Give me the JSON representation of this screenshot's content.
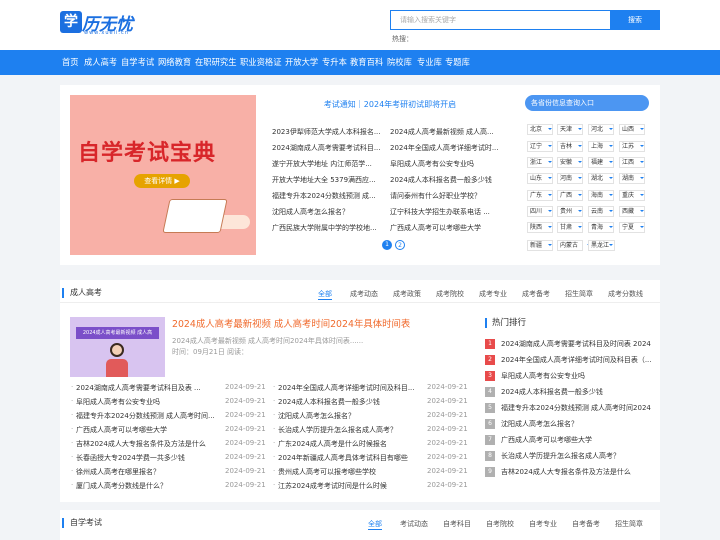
{
  "header": {
    "logo_mark": "学",
    "logo_name": "历无忧",
    "logo_url": "www.xueli.cn",
    "search_placeholder": "请输入搜索关键字",
    "search_button": "搜索",
    "hot_label": "热搜："
  },
  "nav": [
    "首页",
    "成人高考",
    "自学考试",
    "网络教育",
    "在职研究生",
    "职业资格证",
    "开放大学",
    "专升本",
    "教育百科",
    "院校库",
    "专业库",
    "专题库"
  ],
  "banner": {
    "title": "自学考试宝典",
    "button": "查看详情 ▶"
  },
  "notice": "考试通知｜2024年考研初试即将开启",
  "news_left": [
    "2023伊犁师范大学成人本科报名...",
    "2024湖南成人高考需要考试科目...",
    "遂宁开放大学地址 内江师范学...",
    "开放大学地址大全 5379满西应...",
    "福建专升本2024分数线预测 成...",
    "沈阳成人高考怎么报名？",
    "广西民族大学附属中学的学校地..."
  ],
  "news_right": [
    "2024成人高考最新视频 成人高...",
    "2024年全国成人高考详细考试时...",
    "阜阳成人高考有公安专业吗",
    "2024成人本科报名费一般多少钱",
    "请问泰州有什么好职业学校？",
    "辽宁科技大学招生办联系电话 ...",
    "广西成人高考可以考哪些大学"
  ],
  "pages": [
    "1",
    "2"
  ],
  "provinces": {
    "title": "各省份信息查询入口",
    "items": [
      "北京",
      "天津",
      "河北",
      "山西",
      "辽宁",
      "吉林",
      "上海",
      "江苏",
      "浙江",
      "安徽",
      "福建",
      "江西",
      "山东",
      "河南",
      "湖北",
      "湖南",
      "广东",
      "广西",
      "海南",
      "重庆",
      "四川",
      "贵州",
      "云南",
      "西藏",
      "陕西",
      "甘肃",
      "青海",
      "宁夏",
      "新疆",
      "内蒙古",
      "黑龙江"
    ]
  },
  "section1": {
    "title": "成人高考",
    "tabs": [
      "全部",
      "成考动态",
      "成考政策",
      "成考院校",
      "成考专业",
      "成考备考",
      "招生简章",
      "成考分数线"
    ],
    "featured": {
      "image_label": "2024成人高考最新视频 成人高",
      "title": "2024成人高考最新视频 成人高考时间2024年具体时间表",
      "desc": "2024成人高考最新视频 成人高考时间2024年具体时间表......",
      "time": "时间：09月21日 阅读："
    },
    "list_left": [
      {
        "t": "2024湖南成人高考需要考试科目及表 ...",
        "d": "2024-09-21"
      },
      {
        "t": "阜阳成人高考有公安专业吗",
        "d": "2024-09-21"
      },
      {
        "t": "福建专升本2024分数线预测 成人高考时间...",
        "d": "2024-09-21"
      },
      {
        "t": "广西成人高考可以考哪些大学",
        "d": "2024-09-21"
      },
      {
        "t": "吉林2024成人大专报名条件及方法是什么",
        "d": "2024-09-21"
      },
      {
        "t": "长春函授大专2024学费一共多少钱",
        "d": "2024-09-21"
      },
      {
        "t": "徐州成人高考在哪里报名？",
        "d": "2024-09-21"
      },
      {
        "t": "厦门成人高考分数线是什么？",
        "d": "2024-09-21"
      }
    ],
    "list_right": [
      {
        "t": "2024年全国成人高考详细考试时间及科目...",
        "d": "2024-09-21"
      },
      {
        "t": "2024成人本科报名费一般多少钱",
        "d": "2024-09-21"
      },
      {
        "t": "沈阳成人高考怎么报名？",
        "d": "2024-09-21"
      },
      {
        "t": "长治成人学历提升怎么报名成人高考？",
        "d": "2024-09-21"
      },
      {
        "t": "广东2024成人高考是什么时候报名",
        "d": "2024-09-21"
      },
      {
        "t": "2024年新疆成人高考具体考试科目有哪些",
        "d": "2024-09-21"
      },
      {
        "t": "贵州成人高考可以报考哪些学校",
        "d": "2024-09-21"
      },
      {
        "t": "江苏2024成考考试时间是什么时候",
        "d": "2024-09-21"
      }
    ]
  },
  "hot_rank": {
    "title": "热门排行",
    "items": [
      "2024湖南成人高考需要考试科目及时间表 2024...",
      "2024年全国成人高考详细考试时间及科目表（...",
      "阜阳成人高考有公安专业吗",
      "2024成人本科报名费一般多少钱",
      "福建专升本2024分数线预测 成人高考时间2024...",
      "沈阳成人高考怎么报名？",
      "广西成人高考可以考哪些大学",
      "长治成人学历提升怎么报名成人高考？",
      "吉林2024成人大专报名条件及方法是什么"
    ]
  },
  "section2": {
    "title": "自学考试",
    "tabs": [
      "全部",
      "考试动态",
      "自考科目",
      "自考院校",
      "自考专业",
      "自考备考",
      "招生简章"
    ]
  },
  "colors": {
    "accent": "#1e80f0",
    "rank_top": "#e84b4b",
    "rank_other": "#b0b0b0",
    "featured_title": "#f06a2c"
  }
}
